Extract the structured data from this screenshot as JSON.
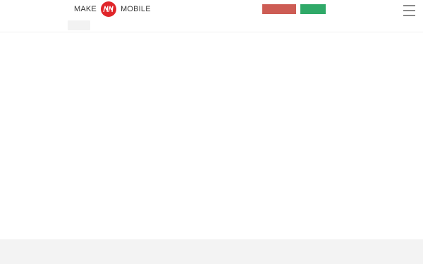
{
  "header": {
    "logo": {
      "left_word": "MAKE",
      "right_word": "MOBILE",
      "badge_icon": "mm-logo-badge",
      "badge_color": "#e0262a"
    },
    "buttons": {
      "primary_color": "#cd5c54",
      "secondary_color": "#2fa968"
    },
    "menu_icon": "hamburger-menu-icon"
  },
  "theme": {
    "background": "#ffffff",
    "footer_background": "#f3f3f3",
    "text_color": "#333333"
  }
}
